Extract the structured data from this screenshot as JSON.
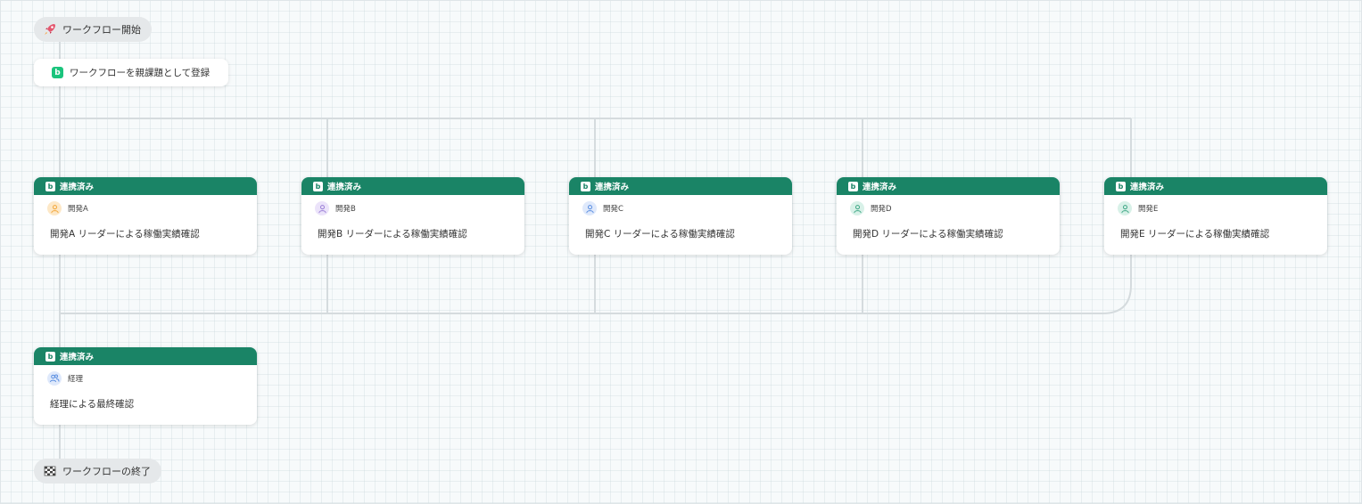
{
  "start": {
    "label": "ワークフロー開始",
    "icon": "rocket-icon"
  },
  "register": {
    "label": "ワークフローを親課題として登録",
    "icon": "b-logo-icon"
  },
  "end": {
    "label": "ワークフローの終了",
    "icon": "checkered-flag-icon"
  },
  "status_label": "連携済み",
  "logo_letter": "b",
  "parallel_tasks": [
    {
      "assignee": "開発A",
      "title": "開発A リーダーによる稼働実績確認",
      "avatar_color": "#f3a73b",
      "avatar_bg": "#fde8c7"
    },
    {
      "assignee": "開発B",
      "title": "開発B リーダーによる稼働実績確認",
      "avatar_color": "#9b7fd6",
      "avatar_bg": "#ebe3fa"
    },
    {
      "assignee": "開発C",
      "title": "開発C リーダーによる稼働実績確認",
      "avatar_color": "#5a8ee0",
      "avatar_bg": "#dfe9fb"
    },
    {
      "assignee": "開発D",
      "title": "開発D リーダーによる稼働実績確認",
      "avatar_color": "#3fa785",
      "avatar_bg": "#d8f1e8"
    },
    {
      "assignee": "開発E",
      "title": "開発E リーダーによる稼働実績確認",
      "avatar_color": "#3fa785",
      "avatar_bg": "#d8f1e8"
    }
  ],
  "final_task": {
    "assignee": "経理",
    "title": "経理による最終確認",
    "avatar_color": "#5a8ee0",
    "avatar_bg": "#dfe9fb",
    "icon": "group-icon"
  },
  "colors": {
    "card_header": "#1a8466",
    "backlog_logo": "#1bc47d",
    "connector": "#d5dbde"
  }
}
